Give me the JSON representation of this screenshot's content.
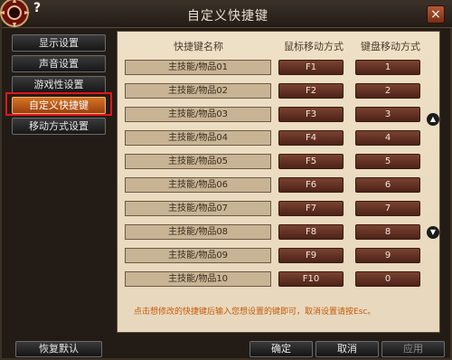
{
  "title": "自定义快捷键",
  "help_glyph": "?",
  "close_glyph": "×",
  "sidebar": {
    "items": [
      {
        "label": "显示设置"
      },
      {
        "label": "声音设置"
      },
      {
        "label": "游戏性设置"
      },
      {
        "label": "自定义快捷键"
      },
      {
        "label": "移动方式设置"
      }
    ]
  },
  "table": {
    "headers": {
      "name": "快捷键名称",
      "mouse": "鼠标移动方式",
      "keyboard": "键盘移动方式"
    },
    "rows": [
      {
        "name": "主技能/物品01",
        "mouse": "F1",
        "keyboard": "1"
      },
      {
        "name": "主技能/物品02",
        "mouse": "F2",
        "keyboard": "2"
      },
      {
        "name": "主技能/物品03",
        "mouse": "F3",
        "keyboard": "3"
      },
      {
        "name": "主技能/物品04",
        "mouse": "F4",
        "keyboard": "4"
      },
      {
        "name": "主技能/物品05",
        "mouse": "F5",
        "keyboard": "5"
      },
      {
        "name": "主技能/物品06",
        "mouse": "F6",
        "keyboard": "6"
      },
      {
        "name": "主技能/物品07",
        "mouse": "F7",
        "keyboard": "7"
      },
      {
        "name": "主技能/物品08",
        "mouse": "F8",
        "keyboard": "8"
      },
      {
        "name": "主技能/物品09",
        "mouse": "F9",
        "keyboard": "9"
      },
      {
        "name": "主技能/物品10",
        "mouse": "F10",
        "keyboard": "0"
      }
    ]
  },
  "hint": "点击想修改的快捷键后输入您想设置的键即可，取消设置请按Esc。",
  "scroll": {
    "up_glyph": "▲",
    "down_glyph": "▼"
  },
  "footer": {
    "restore_default": "恢复默认",
    "confirm": "确定",
    "cancel": "取消",
    "apply": "应用"
  },
  "colors": {
    "accent": "#d57426",
    "highlight_box": "#e0161a",
    "hint_text": "#c55b0b"
  }
}
